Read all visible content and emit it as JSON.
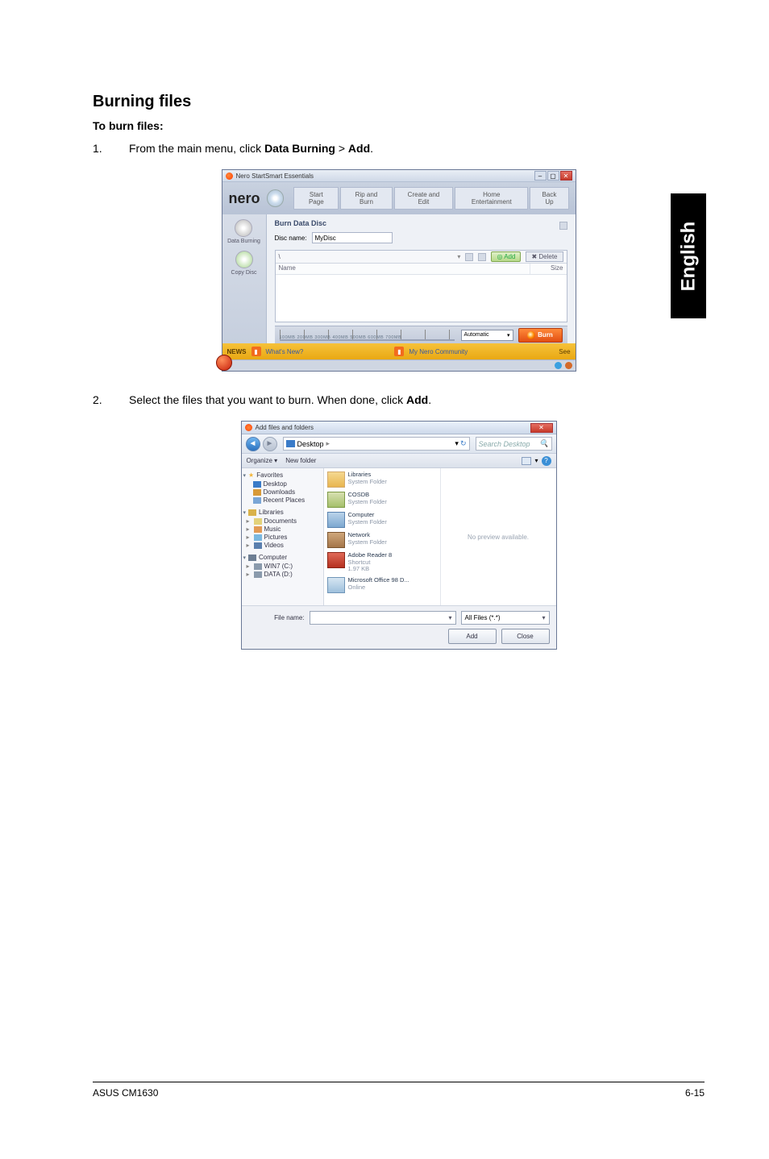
{
  "language_tab": "English",
  "section_title": "Burning files",
  "sub_title": "To burn files:",
  "steps": {
    "s1_num": "1.",
    "s1_a": "From the main menu, click ",
    "s1_b": "Data Burning",
    "s1_c": " > ",
    "s1_d": "Add",
    "s1_e": ".",
    "s2_num": "2.",
    "s2_a": "Select the files that you want to burn. When done, click ",
    "s2_b": "Add",
    "s2_c": "."
  },
  "nero": {
    "title": "Nero StartSmart Essentials",
    "logo": "nero",
    "tabs": {
      "t1": "Start Page",
      "t2": "Rip and Burn",
      "t3": "Create and Edit",
      "t4": "Home Entertainment",
      "t5": "Back Up"
    },
    "sidebar": {
      "data_burning": "Data Burning",
      "copy_disc": "Copy Disc"
    },
    "section": "Burn Data Disc",
    "disc_name_label": "Disc name:",
    "disc_name_value": "MyDisc",
    "file_area": {
      "root": "\\",
      "add": "Add",
      "play": "",
      "col_name": "Name",
      "col_size": "Size"
    },
    "auto": "Automatic",
    "burn": "Burn",
    "news": {
      "label": "NEWS",
      "link1": "What's New?",
      "link2": "My Nero Community",
      "see": "See"
    }
  },
  "dlg": {
    "title": "Add files and folders",
    "crumb": "Desktop",
    "search_placeholder": "Search Desktop",
    "toolbar": {
      "organize": "Organize ▾",
      "newfolder": "New folder"
    },
    "side": {
      "favorites": "Favorites",
      "desktop": "Desktop",
      "downloads": "Downloads",
      "recent": "Recent Places",
      "libraries": "Libraries",
      "documents": "Documents",
      "music": "Music",
      "pictures": "Pictures",
      "videos": "Videos",
      "computer": "Computer",
      "drive_c": "WIN7 (C:)",
      "drive_d": "DATA (D:)"
    },
    "files": {
      "f1n": "Libraries",
      "f1s": "System Folder",
      "f2n": "COSDB",
      "f2s": "System Folder",
      "f3n": "Computer",
      "f3s": "System Folder",
      "f4n": "Network",
      "f4s": "System Folder",
      "f5n": "Adobe Reader 8",
      "f5s1": "Shortcut",
      "f5s2": "1.97 KB",
      "f6n": "Microsoft Office 98 D...",
      "f6s": "Online"
    },
    "preview": "No preview available.",
    "filename_label": "File name:",
    "filter": "All Files (*.*)",
    "btn_add": "Add",
    "btn_close": "Close"
  },
  "footer": {
    "left": "ASUS CM1630",
    "right": "6-15"
  }
}
